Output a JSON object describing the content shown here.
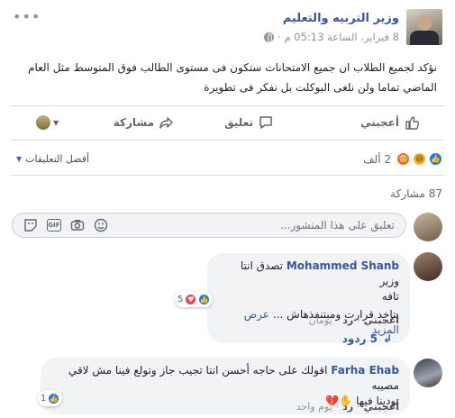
{
  "post": {
    "page_name": "وزير التربيه والتعليم",
    "time": "8 فبراير، الساعة 05:13 م",
    "text": "نؤكد لجميع الطلاب ان جميع الامتحانات ستكون فى مستوى الطالب فوق المتوسط مثل العام الماضي تماما ولن نلغى البوكلت بل نفكر فى تطويرة"
  },
  "actions": {
    "like": "أعجبني",
    "comment": "تعليق",
    "share": "مشاركة"
  },
  "reactions": {
    "count": "2 ألف",
    "sort_label": "أفضل التعليقات",
    "shares": "87 مشاركة"
  },
  "composer": {
    "placeholder": "تعليق على هذا المنشور..."
  },
  "comments": [
    {
      "name": "Mohammed Shanb",
      "line1": "تصدق انتا وزير",
      "line2": "تافه",
      "line3": "بتاخد قرارت ومبتنفذهاش ...",
      "see_more": "عرض المزيد",
      "like": "أعجبني",
      "reply": "رد",
      "time": "يومان",
      "reaction_count": "5",
      "replies": "5 ردود"
    },
    {
      "name": "Farha Ehab",
      "line1": "اقولك على حاجه أحسن انتا تجيب جاز وتولع فينا مش لاقي مصيبه",
      "line2": "تودينا فيها",
      "emoji": "✋💔",
      "like": "أعجبني",
      "reply": "رد",
      "time": "يوم واحد",
      "reaction_count": "1"
    }
  ],
  "colors": {
    "link": "#365899",
    "like_blue": "#1877f2",
    "muted": "#90949c",
    "bubble": "#f2f3f5"
  }
}
